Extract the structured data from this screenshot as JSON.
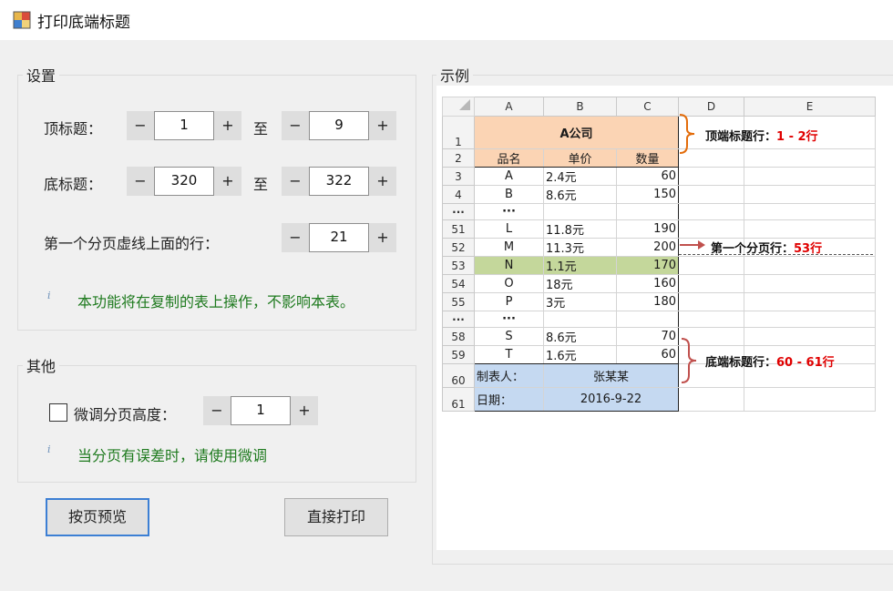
{
  "window": {
    "title": "打印底端标题"
  },
  "settings": {
    "legend": "设置",
    "top_title": {
      "label": "顶标题：",
      "from": "1",
      "to_label": "至",
      "to": "9"
    },
    "bottom_title": {
      "label": "底标题：",
      "from": "320",
      "to_label": "至",
      "to": "322"
    },
    "first_break": {
      "label": "第一个分页虚线上面的行：",
      "value": "21"
    },
    "minus": "−",
    "plus": "+",
    "info_icon": "i",
    "note": "本功能将在复制的表上操作，不影响本表。"
  },
  "other": {
    "legend": "其他",
    "fine_tune": {
      "label": "微调分页高度：",
      "value": "1",
      "checked": false
    },
    "note": "当分页有误差时，请使用微调"
  },
  "buttons": {
    "preview": "按页预览",
    "print": "直接打印"
  },
  "example": {
    "legend": "示例",
    "columns": [
      "A",
      "B",
      "C",
      "D",
      "E"
    ],
    "company": "A公司",
    "headers": [
      "品名",
      "单价",
      "数量"
    ],
    "rows": [
      {
        "n": "3",
        "a": "A",
        "b": "2.4元",
        "c": "60"
      },
      {
        "n": "4",
        "a": "B",
        "b": "8.6元",
        "c": "150"
      },
      {
        "n": "···",
        "a": "···",
        "b": "",
        "c": ""
      },
      {
        "n": "51",
        "a": "L",
        "b": "11.8元",
        "c": "190"
      },
      {
        "n": "52",
        "a": "M",
        "b": "11.3元",
        "c": "200"
      },
      {
        "n": "53",
        "a": "N",
        "b": "1.1元",
        "c": "170"
      },
      {
        "n": "54",
        "a": "O",
        "b": "18元",
        "c": "160"
      },
      {
        "n": "55",
        "a": "P",
        "b": "3元",
        "c": "180"
      },
      {
        "n": "···",
        "a": "···",
        "b": "",
        "c": ""
      },
      {
        "n": "58",
        "a": "S",
        "b": "8.6元",
        "c": "70"
      },
      {
        "n": "59",
        "a": "T",
        "b": "1.6元",
        "c": "60"
      }
    ],
    "footer": [
      {
        "n": "60",
        "label": "制表人：",
        "value": "张某某"
      },
      {
        "n": "61",
        "label": "日期：",
        "value": "2016-9-22"
      }
    ],
    "row_nums_top": [
      "1",
      "2"
    ],
    "annotations": {
      "top_label": "顶端标题行：",
      "top_value": "1 - 2行",
      "break_label": "第一个分页行：",
      "break_value": "53行",
      "bottom_label": "底端标题行：",
      "bottom_value": "60 - 61行"
    },
    "colors": {
      "header_fill": "#fbd4b4",
      "break_fill": "#c4d79b",
      "footer_fill": "#c5d9f1",
      "brace": "#e36c0a",
      "arrow": "#c0504d",
      "emphasis": "#e00000"
    }
  }
}
